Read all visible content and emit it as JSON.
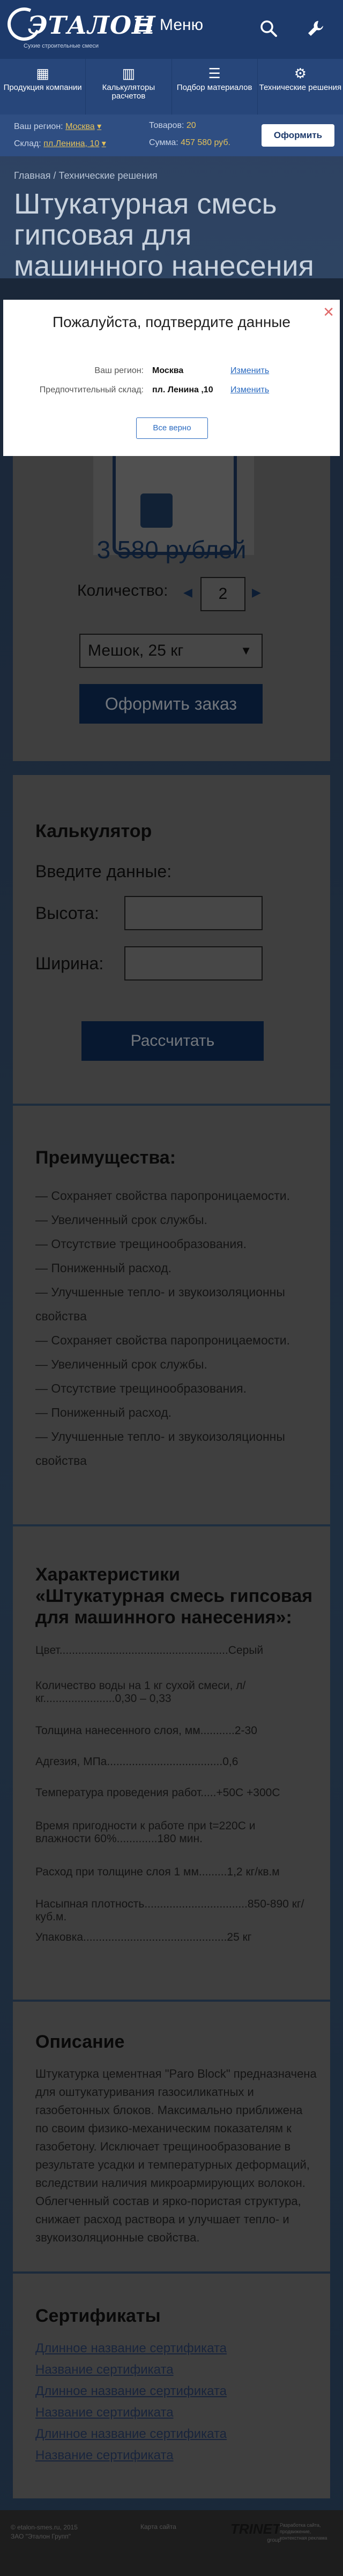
{
  "header": {
    "logo_text": "ЭТАЛОН",
    "logo_sub": "Сухие строительные смеси",
    "menu_label": "Меню"
  },
  "nav": [
    {
      "label": "Продукция компании",
      "icon": "boxes-icon"
    },
    {
      "label": "Калькуляторы расчетов",
      "icon": "calculator-icon"
    },
    {
      "label": "Подбор материалов",
      "icon": "sliders-icon"
    },
    {
      "label": "Технические решения",
      "icon": "gear-icon"
    }
  ],
  "region_bar": {
    "region_label": "Ваш регион:",
    "region_value": "Москва",
    "warehouse_label": "Склад:",
    "warehouse_value": "пл.Ленина, 10",
    "goods_label": "Товаров:",
    "goods_value": "20",
    "sum_label": "Сумма:",
    "sum_value": "457 580 руб.",
    "order_button": "Оформить"
  },
  "breadcrumb": "Главная / Технические решения",
  "page_title": "Штукатурная смесь гипсовая для машинного нанесения",
  "modal": {
    "title": "Пожалуйста, подтвердите данные",
    "region_label": "Ваш регион:",
    "region_value": "Москва",
    "region_link": "Изменить",
    "warehouse_label": "Предпочтительный склад:",
    "warehouse_value": "пл. Ленина ,10",
    "warehouse_link": "Изменить",
    "confirm_button": "Все верно"
  },
  "product": {
    "price": "3 580 рублей",
    "qty_label": "Количество:",
    "qty_value": "2",
    "package": "Мешок,  25 кг",
    "order_button": "Оформить заказ"
  },
  "calculator": {
    "title": "Калькулятор",
    "subtitle": "Введите данные:",
    "height_label": "Высота:",
    "width_label": "Ширина:",
    "button": "Рассчитать"
  },
  "advantages": {
    "title": "Преимущества:",
    "items": [
      "— Сохраняет свойства паропроницаемости.",
      "— Увеличенный срок службы.",
      "— Отсутствие трещинообразования.",
      "— Пониженный расход.",
      "— Улучшенные тепло- и звукоизоляционны свойства",
      "— Сохраняет свойства паропроницаемости.",
      "— Увеличенный срок службы.",
      "— Отсутствие трещинообразования.",
      "— Пониженный расход.",
      "— Улучшенные тепло- и звукоизоляционны свойства"
    ]
  },
  "characteristics": {
    "title": "Характеристики «Штукатурная смесь гипсовая для машинного нанесения»:",
    "rows": [
      "Цвет......................................................Серый",
      "Количество воды на 1 кг сухой смеси, л/кг.......................0,30 – 0,33",
      "Толщина нанесенного слоя, мм...........2-30",
      "Адгезия, МПа.....................................0,6",
      "Температура проведения работ.....+50С +300С",
      "Время пригодности к работе при t=220С и влажности 60%.............180 мин.",
      "Расход при толщине слоя 1 мм.........1,2 кг/кв.м",
      "Насыпная плотность.................................850-890 кг/куб.м.",
      "Упаковка..............................................25 кг"
    ]
  },
  "description": {
    "title": "Описание",
    "text": "Штукатурка цементная \"Paro Block\" предназначена для оштукатуривания газосиликатных и газобетонных блоков. Максимально приближена по своим физико-механическим показателям к газобетону. Исключает трещинообразование в результате усадки и температурных деформаций, вследствии наличия микроармирующих волокон. Облегченный состав и ярко-пористая структура, снижает расход раствора и улучшает тепло- и звукоизоляционные свойства."
  },
  "certificates": {
    "title": "Сертификаты",
    "links": [
      "Длинное название сертификата",
      "Название сертификата",
      "Длинное название сертификата",
      "Название сертификата",
      "Длинное название сертификата",
      "Название сертификата"
    ]
  },
  "footer": {
    "copyright": "© etalon-smes.ru, 2015",
    "company": "ЗАО \"Эталон Групп\"",
    "mid": "Карта сайта",
    "dev_logo": "TRINET",
    "dev_group": "group",
    "dev_note": "Разработка сайта, продвижение, контекстная реклама"
  }
}
